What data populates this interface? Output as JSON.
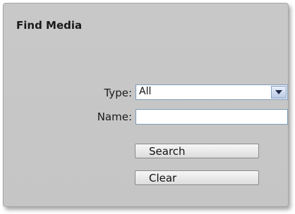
{
  "panel": {
    "title": "Find Media"
  },
  "form": {
    "type_label": "Type:",
    "type_value": "All",
    "name_label": "Name:",
    "name_value": "",
    "name_placeholder": ""
  },
  "buttons": {
    "search_label": "Search",
    "clear_label": "Clear"
  }
}
